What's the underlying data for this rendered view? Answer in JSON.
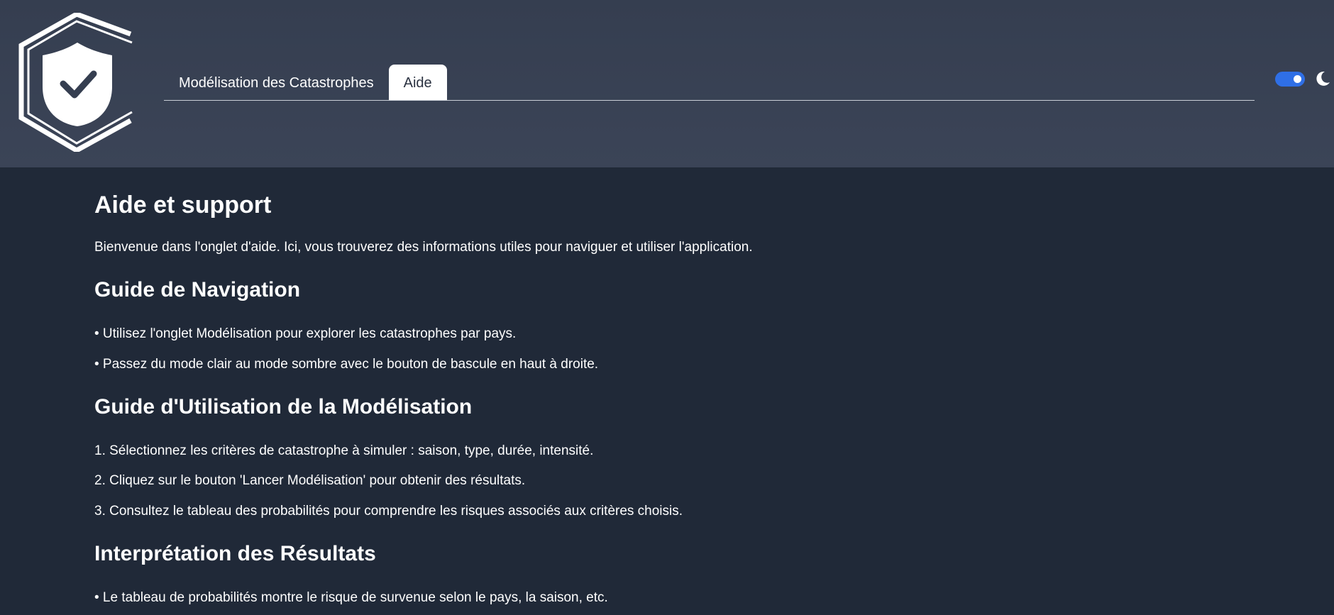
{
  "header": {
    "tabs": [
      {
        "label": "Modélisation des Catastrophes",
        "active": false
      },
      {
        "label": "Aide",
        "active": true
      }
    ],
    "theme_toggle": {
      "on": true
    },
    "accent_color": "#2f6fe6"
  },
  "main": {
    "title": "Aide et support",
    "intro": "Bienvenue dans l'onglet d'aide. Ici, vous trouverez des informations utiles pour naviguer et utiliser l'application.",
    "sections": [
      {
        "heading": "Guide de Navigation",
        "items": [
          "• Utilisez l'onglet Modélisation pour explorer les catastrophes par pays.",
          "• Passez du mode clair au mode sombre avec le bouton de bascule en haut à droite."
        ]
      },
      {
        "heading": "Guide d'Utilisation de la Modélisation",
        "items": [
          "1. Sélectionnez les critères de catastrophe à simuler : saison, type, durée, intensité.",
          "2. Cliquez sur le bouton 'Lancer Modélisation' pour obtenir des résultats.",
          "3. Consultez le tableau des probabilités pour comprendre les risques associés aux critères choisis."
        ]
      },
      {
        "heading": "Interprétation des Résultats",
        "items": [
          "• Le tableau de probabilités montre le risque de survenue selon le pays, la saison, etc."
        ]
      }
    ]
  }
}
